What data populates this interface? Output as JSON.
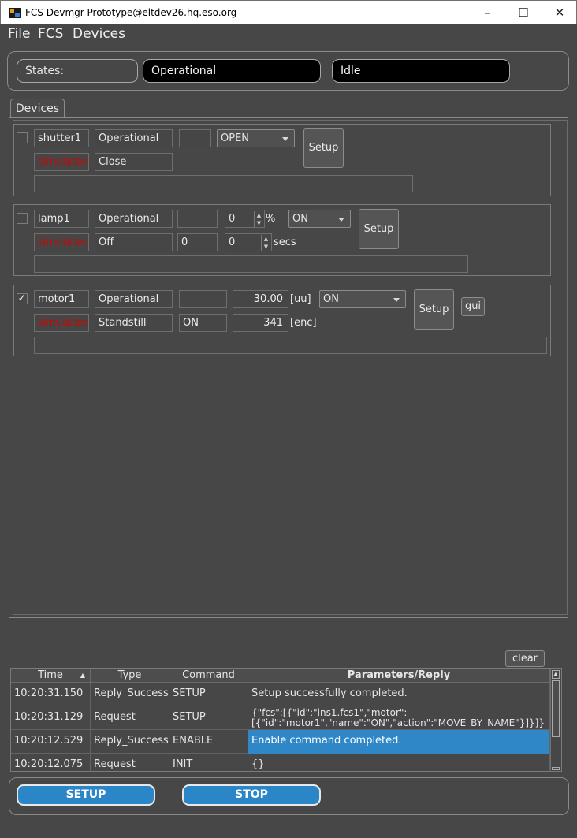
{
  "window": {
    "title": "FCS Devmgr Prototype@eltdev26.hq.eso.org"
  },
  "menu": [
    "File",
    "FCS",
    "Devices"
  ],
  "states": {
    "label": "States:",
    "state": "Operational",
    "substate": "Idle"
  },
  "tab": "Devices",
  "devices": [
    {
      "name": "shutter1",
      "checked": false,
      "state": "Operational",
      "sim": "simulated",
      "substate": "Close",
      "empty_field": "",
      "combo": "OPEN",
      "setup": "Setup"
    },
    {
      "name": "lamp1",
      "checked": false,
      "state": "Operational",
      "sim": "simulated",
      "substate": "Off",
      "empty_field": "",
      "intensity": "0",
      "intensity_unit": "%",
      "combo": "ON",
      "time_a": "0",
      "time_b": "0",
      "time_unit": "secs",
      "setup": "Setup"
    },
    {
      "name": "motor1",
      "checked": true,
      "check_mark": "✓",
      "state": "Operational",
      "sim": "simulated",
      "substate": "Standstill",
      "empty_field": "",
      "enabled": "ON",
      "position": "30.00",
      "position_unit": "[uu]",
      "encoder": "341",
      "encoder_unit": "[enc]",
      "combo": "ON",
      "setup": "Setup",
      "gui": "gui"
    }
  ],
  "log": {
    "clear_label": "clear",
    "columns": [
      "Time",
      "Type",
      "Command",
      "Parameters/Reply"
    ],
    "rows": [
      {
        "time": "10:20:31.150",
        "type": "Reply_Success",
        "command": "SETUP",
        "params": "Setup successfully completed."
      },
      {
        "time": "10:20:31.129",
        "type": "Request",
        "command": "SETUP",
        "params": "{\"fcs\":[{\"id\":\"ins1.fcs1\",\"motor\": [{\"id\":\"motor1\",\"name\":\"ON\",\"action\":\"MOVE_BY_NAME\"}]}]}"
      },
      {
        "time": "10:20:12.529",
        "type": "Reply_Success",
        "command": "ENABLE",
        "params": "Enable command completed."
      },
      {
        "time": "10:20:12.075",
        "type": "Request",
        "command": "INIT",
        "params": "{}"
      }
    ]
  },
  "actions": {
    "setup": "SETUP",
    "stop": "STOP"
  },
  "colors": {
    "accent": "#2b86c7",
    "simulated": "#d40000",
    "background": "#474747"
  }
}
